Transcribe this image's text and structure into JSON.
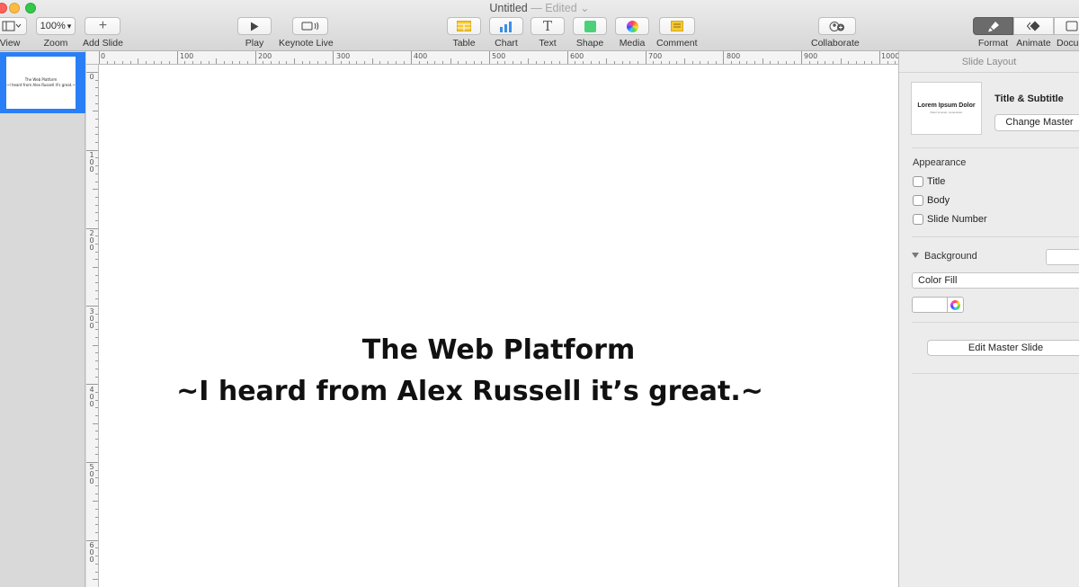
{
  "window": {
    "title": "Untitled",
    "status": "— Edited"
  },
  "toolbar": {
    "view": "View",
    "zoom_value": "100%",
    "zoom": "Zoom",
    "add_slide": "Add Slide",
    "play": "Play",
    "keynote_live": "Keynote Live",
    "table": "Table",
    "chart": "Chart",
    "text": "Text",
    "text_glyph": "T",
    "shape": "Shape",
    "media": "Media",
    "comment": "Comment",
    "collaborate": "Collaborate",
    "format": "Format",
    "animate": "Animate",
    "document": "Docu"
  },
  "thumbnail": {
    "line1": "The Web Platform",
    "line2": "~I heard from Alex Russell it's great.~"
  },
  "ruler": {
    "top": [
      "0",
      "100",
      "200",
      "300",
      "400",
      "500",
      "600",
      "700",
      "800",
      "900",
      "1000"
    ],
    "left": [
      "0",
      "100",
      "200",
      "300",
      "400",
      "500",
      "600"
    ]
  },
  "slide": {
    "title": "The Web Platform",
    "subtitle": "~I heard from Alex Russell it’s great.~"
  },
  "inspector": {
    "header": "Slide Layout",
    "master_preview_title": "Lorem Ipsum Dolor",
    "master_preview_sub": "Dolor sit amet, consectetur",
    "layout_name": "Title & Subtitle",
    "change_master": "Change Master",
    "appearance": "Appearance",
    "checkboxes": [
      "Title",
      "Body",
      "Slide Number"
    ],
    "background": "Background",
    "fill_type": "Color Fill",
    "edit_master": "Edit Master Slide"
  },
  "colors": {
    "selection": "#2a7ff6",
    "active_tab": "#6b6b6b"
  }
}
